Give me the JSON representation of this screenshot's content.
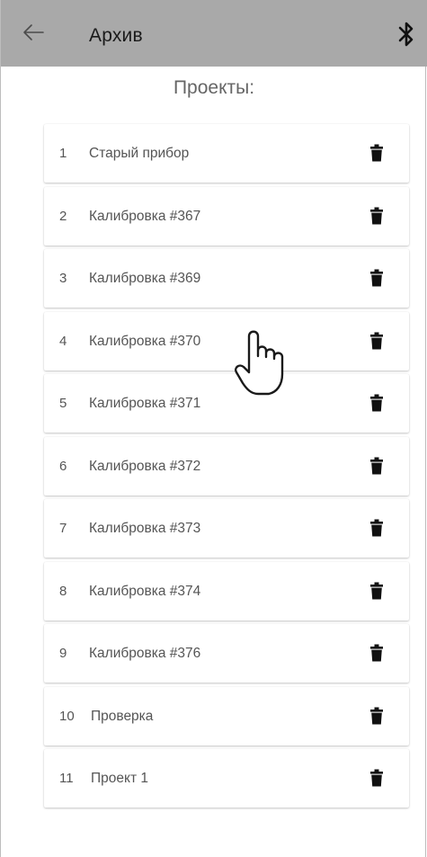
{
  "header": {
    "title": "Архив",
    "back_icon": "arrow-left-icon",
    "bluetooth_icon": "bluetooth-icon"
  },
  "section": {
    "title": "Проекты:"
  },
  "projects": [
    {
      "number": "1",
      "name": "Старый прибор"
    },
    {
      "number": "2",
      "name": "Калибровка #367"
    },
    {
      "number": "3",
      "name": "Калибровка #369"
    },
    {
      "number": "4",
      "name": "Калибровка #370"
    },
    {
      "number": "5",
      "name": "Калибровка #371"
    },
    {
      "number": "6",
      "name": "Калибровка #372"
    },
    {
      "number": "7",
      "name": "Калибровка #373"
    },
    {
      "number": "8",
      "name": "Калибровка #374"
    },
    {
      "number": "9",
      "name": "Калибровка #376"
    },
    {
      "number": "10",
      "name": "Проверка"
    },
    {
      "number": "11",
      "name": "Проект 1"
    }
  ],
  "delete_icon": "trash-icon",
  "cursor_icon": "hand-pointer-icon",
  "colors": {
    "app_bar": "#a9a9a9",
    "background": "#ffffff",
    "text": "#555555",
    "icon": "#111111"
  }
}
